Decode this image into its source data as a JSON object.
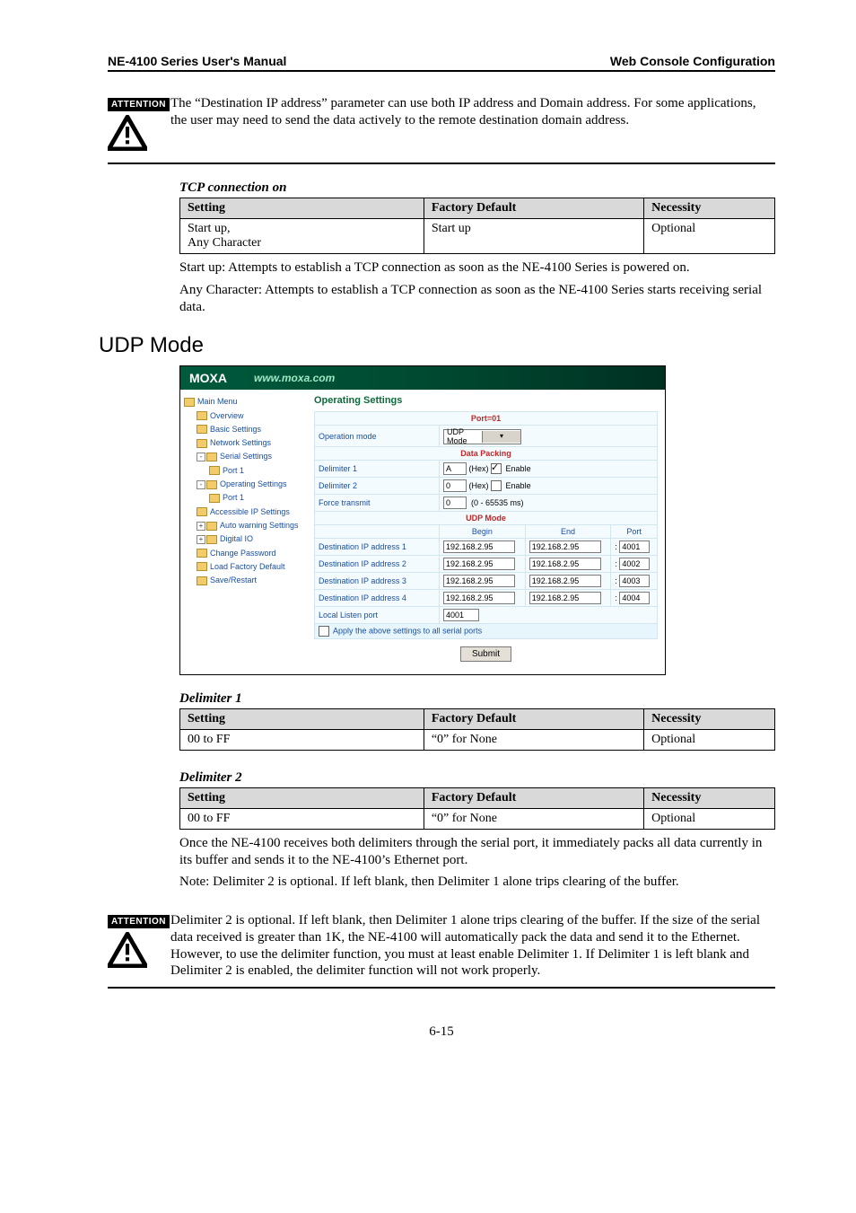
{
  "header": {
    "left": "NE-4100 Series User's Manual",
    "right": "Web Console Configuration"
  },
  "attention1": {
    "label": "ATTENTION",
    "text": "The “Destination IP address” parameter can use both IP address and Domain address. For some applications, the user may need to send the data actively to the remote destination domain address."
  },
  "tcp": {
    "caption": "TCP connection on",
    "headers": {
      "setting": "Setting",
      "default": "Factory Default",
      "necessity": "Necessity"
    },
    "row": {
      "setting1": "Start up,",
      "setting2": "Any Character",
      "default": "Start up",
      "necessity": "Optional"
    },
    "note_start": "Start up: Attempts to establish a TCP connection as soon as the NE-4100 Series is powered on.",
    "note_any": "Any Character: Attempts to establish a TCP connection as soon as the NE-4100 Series starts receiving serial data."
  },
  "udp_heading": "UDP Mode",
  "shot": {
    "logo": "MOXA",
    "url": "www.moxa.com",
    "nav": {
      "main": "Main Menu",
      "overview": "Overview",
      "basic": "Basic Settings",
      "network": "Network Settings",
      "serial": "Serial Settings",
      "port1a": "Port 1",
      "oper": "Operating Settings",
      "port1b": "Port 1",
      "accessible": "Accessible IP Settings",
      "autowarn": "Auto warning Settings",
      "digitalio": "Digital IO",
      "changepw": "Change Password",
      "loadfactory": "Load Factory Default",
      "saverestart": "Save/Restart"
    },
    "title": "Operating Settings",
    "port_section": "Port=01",
    "rows": {
      "opmode": {
        "label": "Operation mode",
        "value": "UDP Mode"
      },
      "packing": "Data Packing",
      "del1": {
        "label": "Delimiter 1",
        "value": "A",
        "hex": "(Hex)",
        "enable": "Enable",
        "checked": true
      },
      "del2": {
        "label": "Delimiter 2",
        "value": "0",
        "hex": "(Hex)",
        "enable": "Enable",
        "checked": false
      },
      "force": {
        "label": "Force transmit",
        "value": "0",
        "hint": "(0 - 65535 ms)"
      },
      "udpmode": "UDP Mode",
      "cols": {
        "begin": "Begin",
        "end": "End",
        "port": "Port"
      },
      "dst1": {
        "label": "Destination IP address 1",
        "begin": "192.168.2.95",
        "end": "192.168.2.95",
        "port": "4001"
      },
      "dst2": {
        "label": "Destination IP address 2",
        "begin": "192.168.2.95",
        "end": "192.168.2.95",
        "port": "4002"
      },
      "dst3": {
        "label": "Destination IP address 3",
        "begin": "192.168.2.95",
        "end": "192.168.2.95",
        "port": "4003"
      },
      "dst4": {
        "label": "Destination IP address 4",
        "begin": "192.168.2.95",
        "end": "192.168.2.95",
        "port": "4004"
      },
      "local": {
        "label": "Local Listen port",
        "value": "4001"
      },
      "applyall": "Apply the above settings to all serial ports",
      "submit": "Submit"
    }
  },
  "delim1": {
    "caption": "Delimiter 1",
    "headers": {
      "setting": "Setting",
      "default": "Factory Default",
      "necessity": "Necessity"
    },
    "row": {
      "setting": "00 to FF",
      "default": "“0” for None",
      "necessity": "Optional"
    }
  },
  "delim2": {
    "caption": "Delimiter 2",
    "headers": {
      "setting": "Setting",
      "default": "Factory Default",
      "necessity": "Necessity"
    },
    "row": {
      "setting": "00 to FF",
      "default": "“0” for None",
      "necessity": "Optional"
    },
    "body1": "Once the NE-4100 receives both delimiters through the serial port, it immediately packs all data currently in its buffer and sends it to the NE-4100’s Ethernet port.",
    "body2": "Note: Delimiter 2 is optional. If left blank, then Delimiter 1 alone trips clearing of the buffer."
  },
  "attention2": {
    "label": "ATTENTION",
    "text": "Delimiter 2 is optional. If left blank, then Delimiter 1 alone trips clearing of the buffer. If the size of the serial data received is greater than 1K, the NE-4100 will automatically pack the data and send it to the Ethernet. However, to use the delimiter function, you must at least enable Delimiter 1. If Delimiter 1 is left blank and Delimiter 2 is enabled, the delimiter function will not work properly."
  },
  "page_num": "6-15"
}
